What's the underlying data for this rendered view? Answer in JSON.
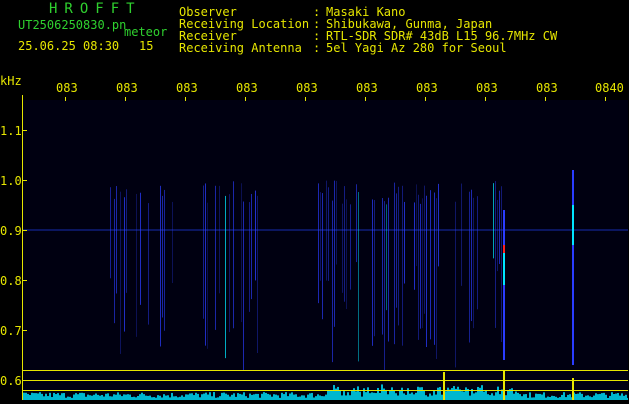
{
  "header": {
    "logo": "HROFFT",
    "filename": "UT2506250830.pn",
    "file_tag": "meteor",
    "datetime": "25.06.25 08:30",
    "count": "15",
    "labels": [
      "Observer",
      "Receiving Location",
      "Receiver",
      "Receiving Antenna"
    ],
    "separators": [
      ":",
      ":",
      ":",
      ":"
    ],
    "values": [
      "Masaki Kano",
      "Shibukawa, Gunma, Japan",
      "RTL-SDR SDR# 43dB L15 96.7MHz CW",
      "5el Yagi Az 280 for Seoul"
    ]
  },
  "axis": {
    "y_unit": "kHz",
    "x_ticks": [
      "083",
      "083",
      "083",
      "083",
      "083",
      "083",
      "083",
      "083",
      "083",
      "0840"
    ],
    "y_ticks": [
      "1.1",
      "1.0",
      "0.9",
      "0.8",
      "0.7",
      "0.6"
    ]
  },
  "colors": {
    "text_green": "#2fd12f",
    "text_yellow": "#e6e600",
    "signal_blue": "#2a3cff",
    "signal_cyan": "#00e5ff",
    "signal_red": "#ff2020"
  }
}
